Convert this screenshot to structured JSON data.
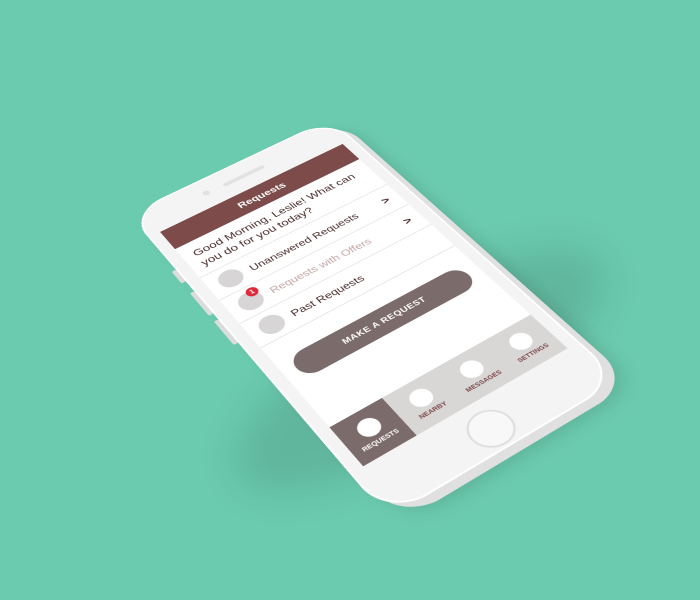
{
  "header": {
    "title": "Requests"
  },
  "greeting": "Good Morning, Leslie! What can you do for you today?",
  "list": [
    {
      "label": "Unanswered Requests",
      "chevron": ">"
    },
    {
      "label": "Requests with Offers",
      "chevron": ">",
      "badge": "1"
    },
    {
      "label": "Past Requests"
    }
  ],
  "make_request_label": "MAKE A REQUEST",
  "tabs": [
    {
      "label": "REQUESTS"
    },
    {
      "label": "NEARBY"
    },
    {
      "label": "MESSAGES"
    },
    {
      "label": "SETTINGS"
    }
  ],
  "colors": {
    "background": "#6bcbae",
    "brand": "#7e4b4b",
    "button": "#7c6b6b",
    "badge": "#e0283c"
  }
}
